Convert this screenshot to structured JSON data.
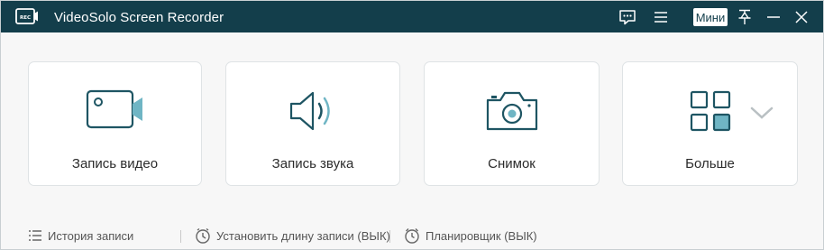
{
  "window": {
    "title": "VideoSolo Screen Recorder",
    "logo_text": "REC",
    "mini_label": "Мини"
  },
  "cards": {
    "video": {
      "label": "Запись видео",
      "icon": "video-camera-icon"
    },
    "audio": {
      "label": "Запись звука",
      "icon": "speaker-icon"
    },
    "snapshot": {
      "label": "Снимок",
      "icon": "camera-icon"
    },
    "more": {
      "label": "Больше",
      "icon": "grid-icon"
    }
  },
  "status": {
    "history": "История записи",
    "record_length": "Установить длину записи (ВЫК)",
    "scheduler": "Планировщик (ВЫК)"
  },
  "colors": {
    "titlebar": "#133e4b",
    "accent": "#1e5563",
    "accent_light": "#6fb5c4",
    "background": "#f7f7f7"
  }
}
